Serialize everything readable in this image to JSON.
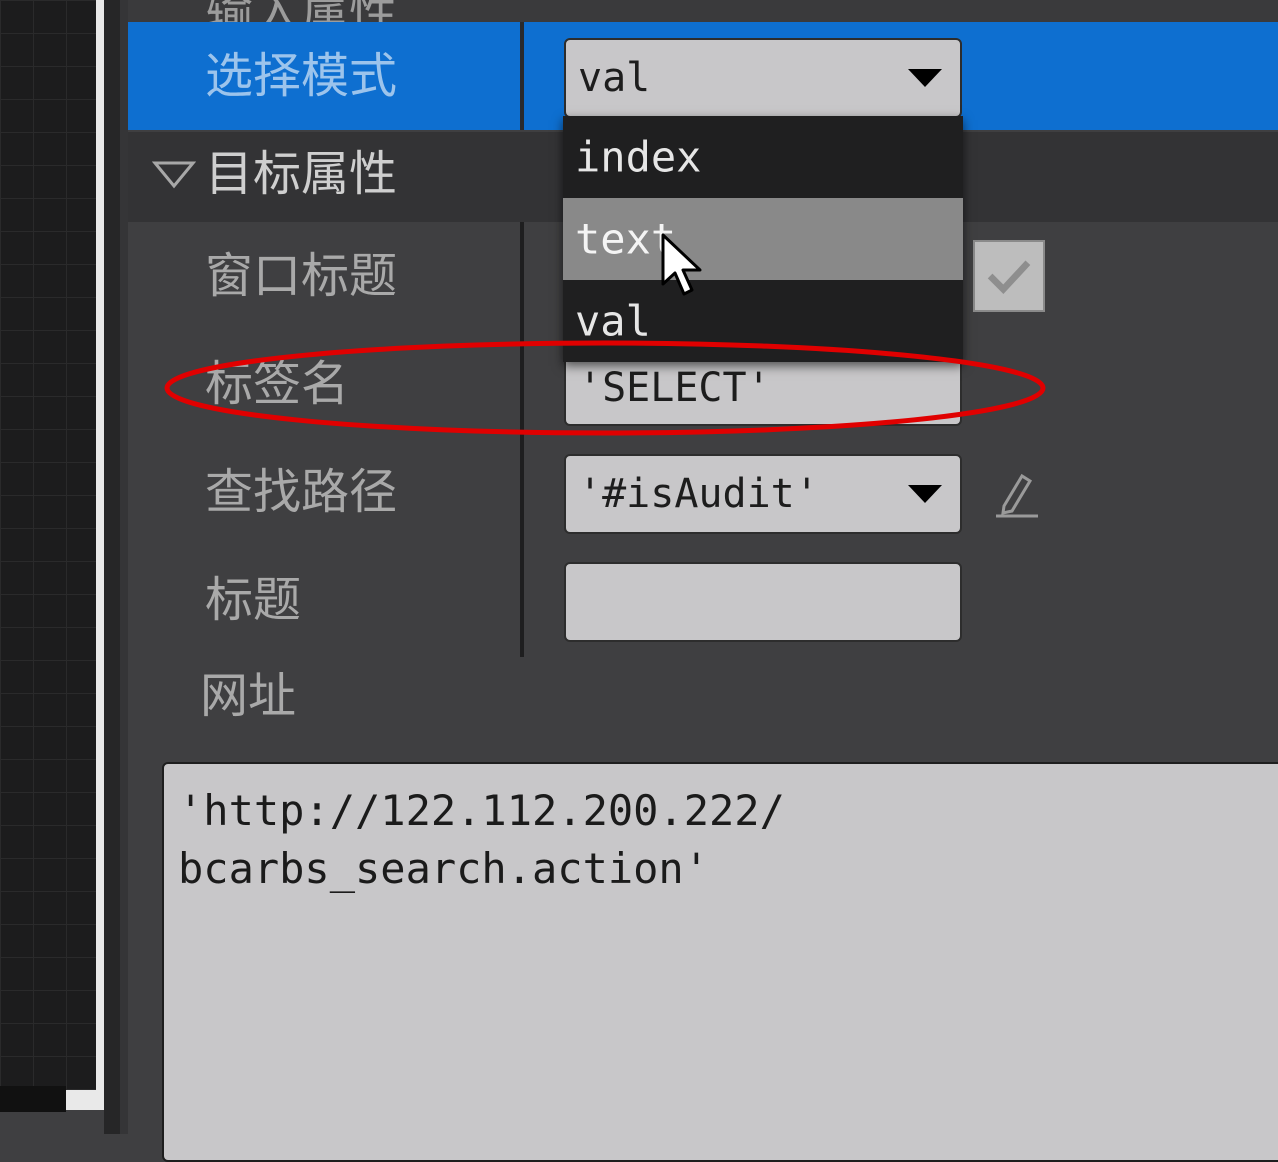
{
  "top_partial_label": "输入属性",
  "select_mode": {
    "label": "选择模式",
    "value": "val"
  },
  "dropdown_options": [
    "index",
    "text",
    "val"
  ],
  "hovered_option": "text",
  "section": {
    "title": "目标属性"
  },
  "properties": {
    "window_title": {
      "label": "窗口标题",
      "checked": true
    },
    "tag_name": {
      "label": "标签名",
      "value": "'SELECT'"
    },
    "find_path": {
      "label": "查找路径",
      "value": "'#isAudit'"
    },
    "title": {
      "label": "标题",
      "value": ""
    },
    "url": {
      "label": "网址",
      "line1": "'http://122.112.200.222/",
      "line2": "bcarbs_search.action'"
    }
  },
  "icons": [
    "triangle-down-icon",
    "caret-down-icon",
    "check-icon",
    "pencil-icon",
    "mouse-cursor-icon"
  ],
  "colors": {
    "selected_row": "#0e6fd0",
    "panel_bg": "#3f3f41",
    "field_bg": "#c8c7c9",
    "annotation": "#e00000"
  }
}
